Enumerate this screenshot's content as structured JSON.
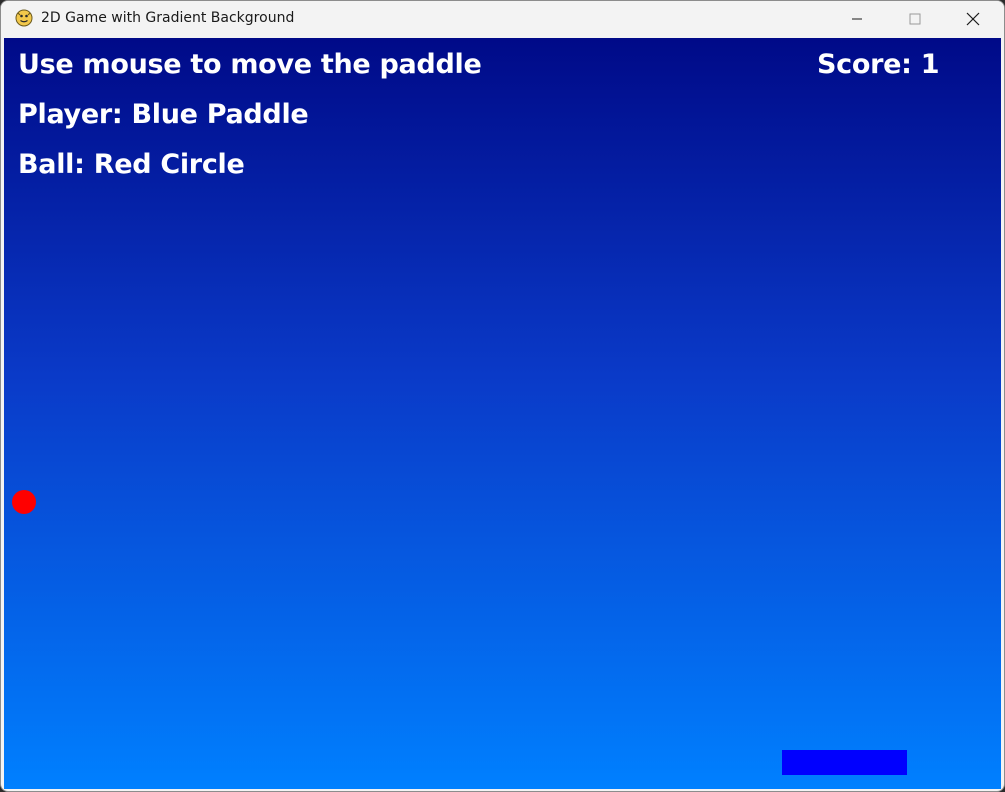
{
  "window": {
    "title": "2D Game with Gradient Background",
    "icon": "python-snake-icon"
  },
  "titlebar_buttons": {
    "minimize": "minimize-icon",
    "maximize": "maximize-icon",
    "close": "close-icon"
  },
  "game": {
    "instruction": "Use mouse to move the paddle",
    "player_label": "Player: Blue Paddle",
    "ball_label": "Ball: Red Circle",
    "score_label": "Score: 1",
    "colors": {
      "gradient_top": "#000a88",
      "gradient_bottom": "#0080ff",
      "ball": "#ff0000",
      "paddle": "#0000ff",
      "text": "#ffffff"
    }
  }
}
